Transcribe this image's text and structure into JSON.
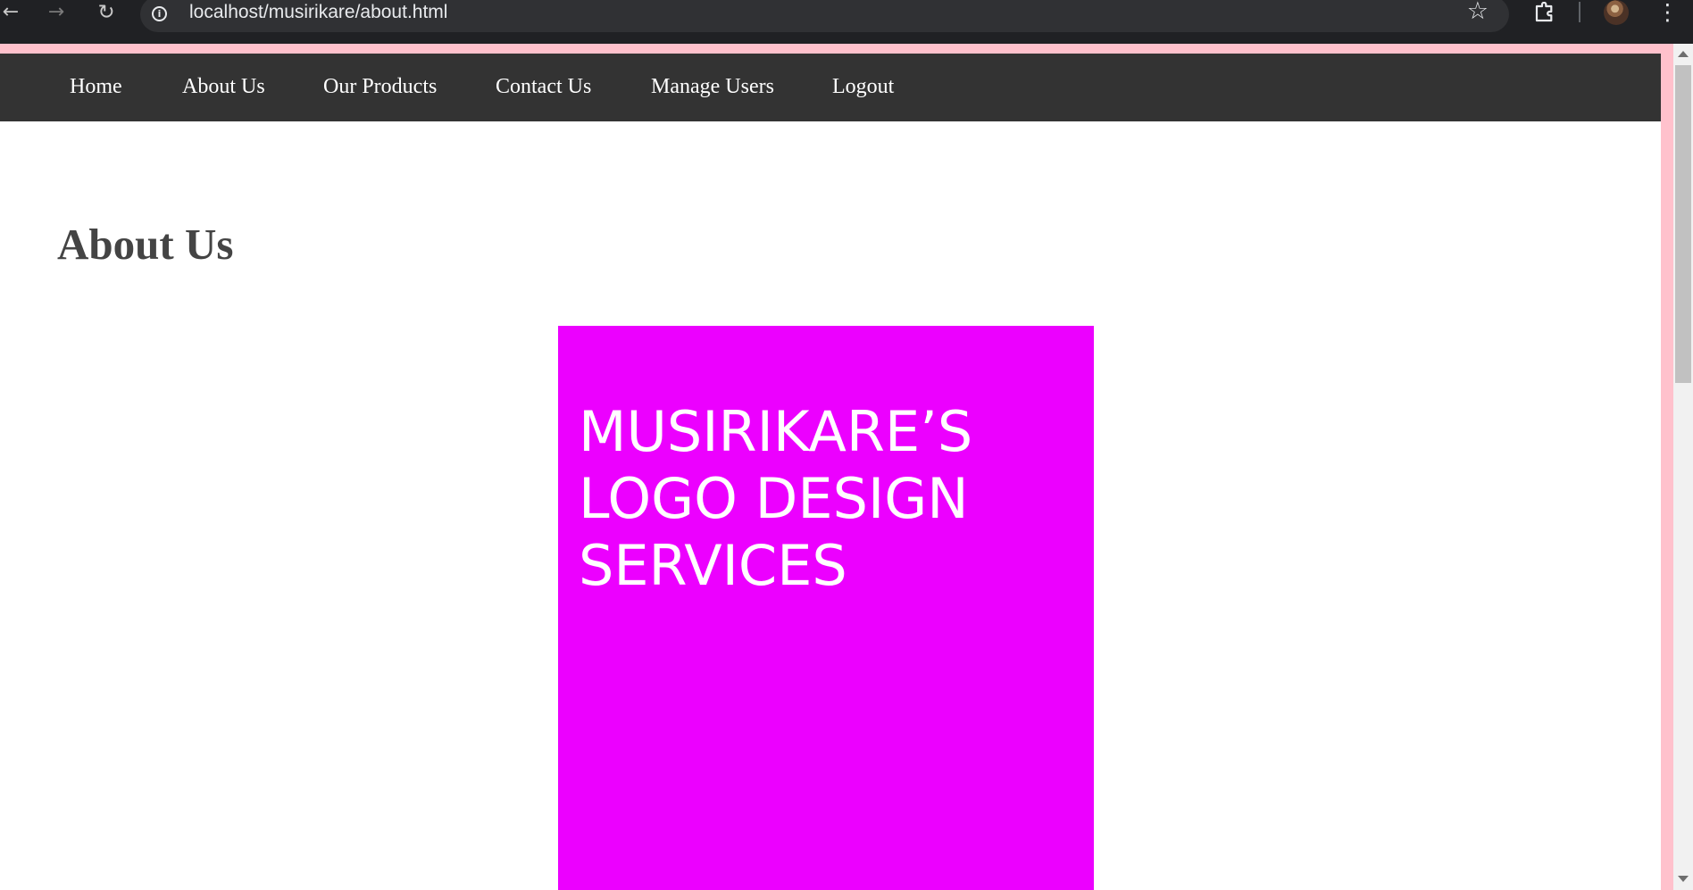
{
  "browser": {
    "address_bar": {
      "url": "localhost/musirikare/about.html"
    },
    "icons": {
      "back": "arrow-left-icon",
      "forward": "arrow-right-icon",
      "reload": "reload-icon",
      "site_info": "info-icon",
      "bookmark": "star-icon",
      "extensions": "puzzle-icon",
      "profile": "avatar",
      "menu": "more-vertical-icon"
    }
  },
  "navigation": {
    "items": [
      {
        "label": "Home"
      },
      {
        "label": "About Us"
      },
      {
        "label": "Our Products"
      },
      {
        "label": "Contact Us"
      },
      {
        "label": "Manage Users"
      },
      {
        "label": "Logout"
      }
    ]
  },
  "main": {
    "heading": "About Us",
    "logo_card": {
      "lines": [
        "MUSIRIKARE’S",
        "LOGO DESIGN",
        "SERVICES"
      ]
    }
  },
  "colors": {
    "navigation_background": "#333333",
    "page_border": "#ffc1cc",
    "logo_card_background": "#ec00ff",
    "heading": "#444444"
  }
}
